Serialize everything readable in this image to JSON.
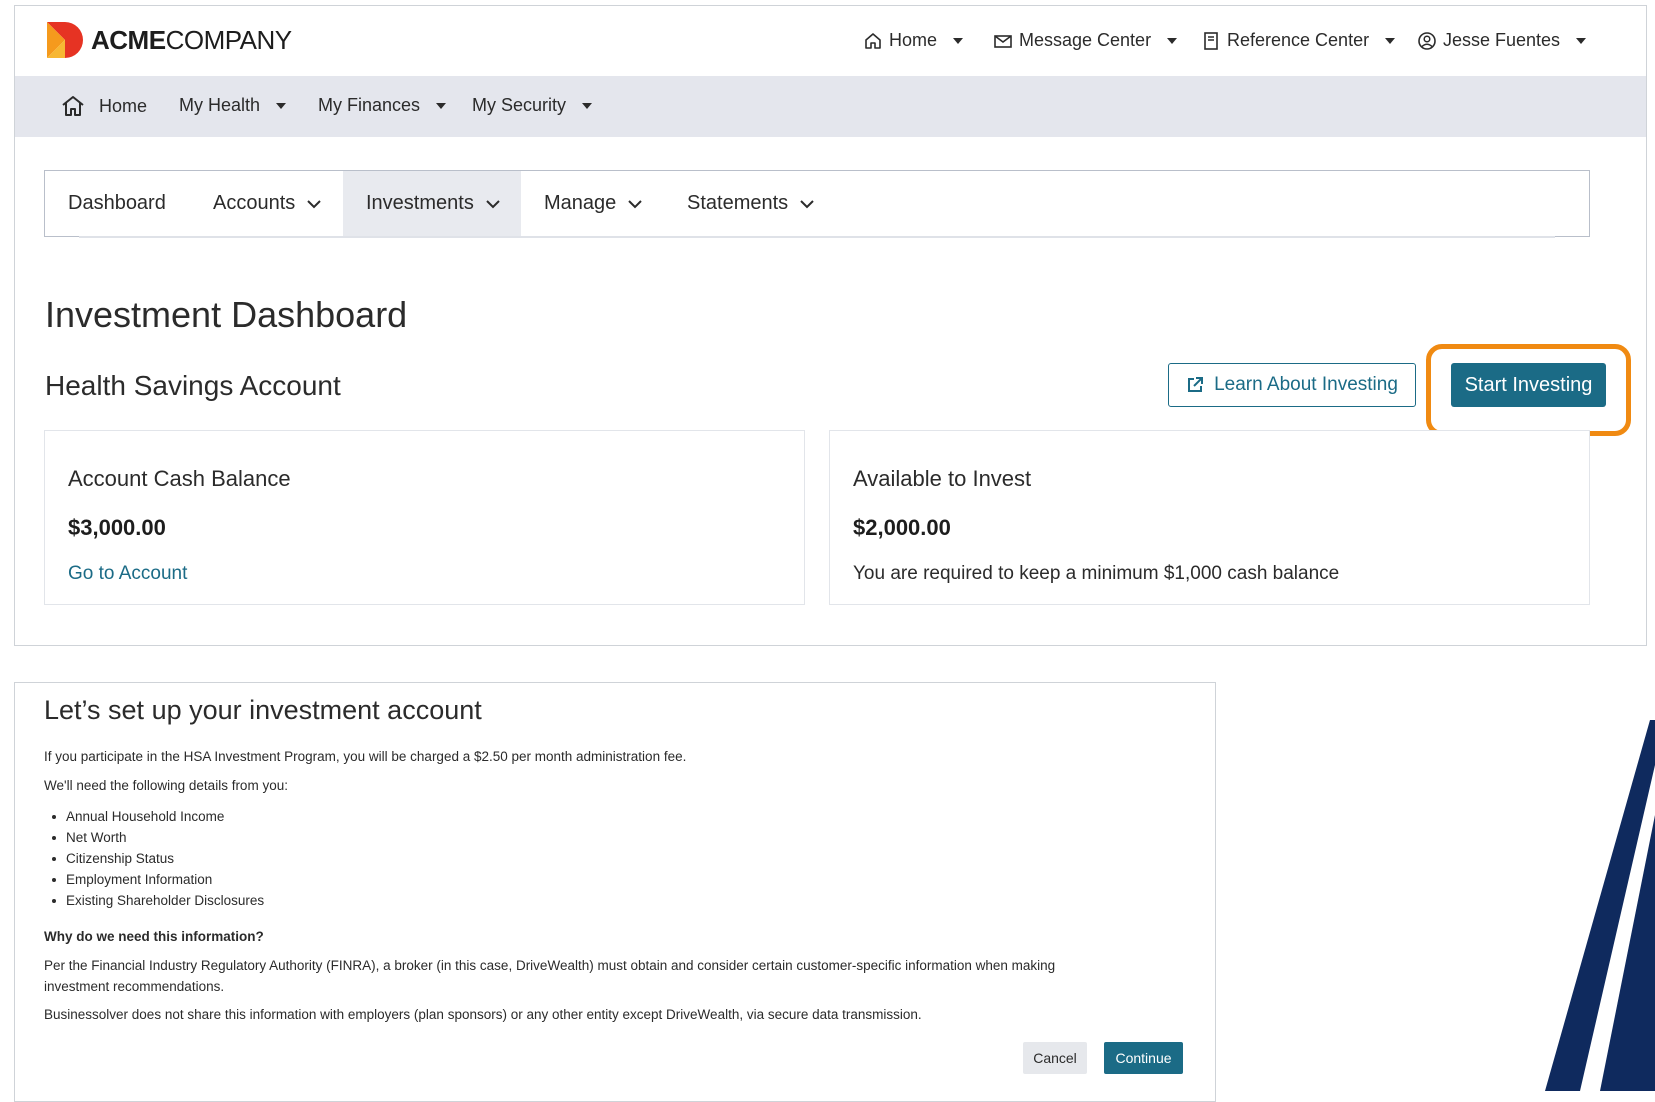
{
  "brand": {
    "bold": "ACME",
    "regular": "COMPANY"
  },
  "colors": {
    "accent": "#1b6b86",
    "highlight": "#f08a12",
    "nav_bg": "#e4e6ed",
    "stripe": "#0f2a5e"
  },
  "utility_nav": [
    {
      "label": "Home",
      "icon": "home-icon"
    },
    {
      "label": "Message Center",
      "icon": "envelope-icon"
    },
    {
      "label": "Reference Center",
      "icon": "book-icon"
    },
    {
      "label": "Jesse Fuentes",
      "icon": "user-circle-icon"
    }
  ],
  "primary_nav": [
    {
      "label": "Home",
      "icon": "home-icon"
    },
    {
      "label": "My Health"
    },
    {
      "label": "My Finances"
    },
    {
      "label": "My Security"
    }
  ],
  "sub_nav": [
    {
      "label": "Dashboard"
    },
    {
      "label": "Accounts"
    },
    {
      "label": "Investments",
      "active": true
    },
    {
      "label": "Manage"
    },
    {
      "label": "Statements"
    }
  ],
  "page": {
    "title": "Investment Dashboard",
    "section_title": "Health Savings Account",
    "learn_button": "Learn About Investing",
    "start_button": "Start Investing"
  },
  "cards": [
    {
      "title": "Account Cash Balance",
      "amount": "$3,000.00",
      "footer": "Go to Account"
    },
    {
      "title": "Available to Invest",
      "amount": "$2,000.00",
      "footer": "You are required to keep a minimum $1,000 cash balance"
    }
  ],
  "modal": {
    "title": "Let’s set up your investment account",
    "fee_text": "If you participate in the HSA Investment Program, you will be charged a $2.50 per month administration fee.",
    "details_intro": "We'll need the following details from you:",
    "details": [
      "Annual Household Income",
      "Net Worth",
      "Citizenship Status",
      "Employment Information",
      "Existing Shareholder Disclosures"
    ],
    "why_heading": "Why do we need this information?",
    "why_line1": "Per the Financial Industry Regulatory Authority (FINRA), a broker (in this case, DriveWealth) must obtain and consider certain customer-specific information when making",
    "why_line2": "investment recommendations.",
    "privacy_text": "Businessolver does not share this information with employers (plan sponsors) or any other entity except DriveWealth, via secure data transmission.",
    "cancel": "Cancel",
    "continue": "Continue"
  }
}
